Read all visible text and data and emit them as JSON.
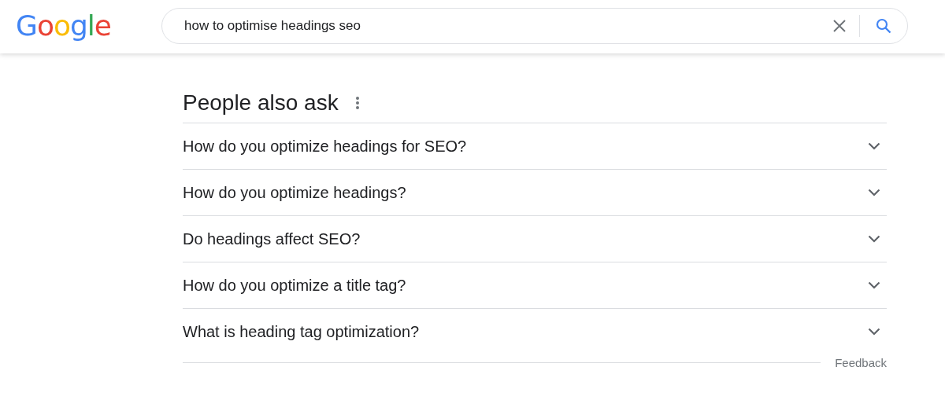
{
  "header": {
    "logo": "Google",
    "search": {
      "value": "how to optimise headings seo"
    }
  },
  "people_also_ask": {
    "title": "People also ask",
    "questions": [
      {
        "text": "How do you optimize headings for SEO?",
        "expanded": false
      },
      {
        "text": "How do you optimize headings?",
        "expanded": false
      },
      {
        "text": "Do headings affect SEO?",
        "expanded": false
      },
      {
        "text": "How do you optimize a title tag?",
        "expanded": false
      },
      {
        "text": "What is heading tag optimization?",
        "expanded": false
      }
    ],
    "feedback": "Feedback"
  }
}
